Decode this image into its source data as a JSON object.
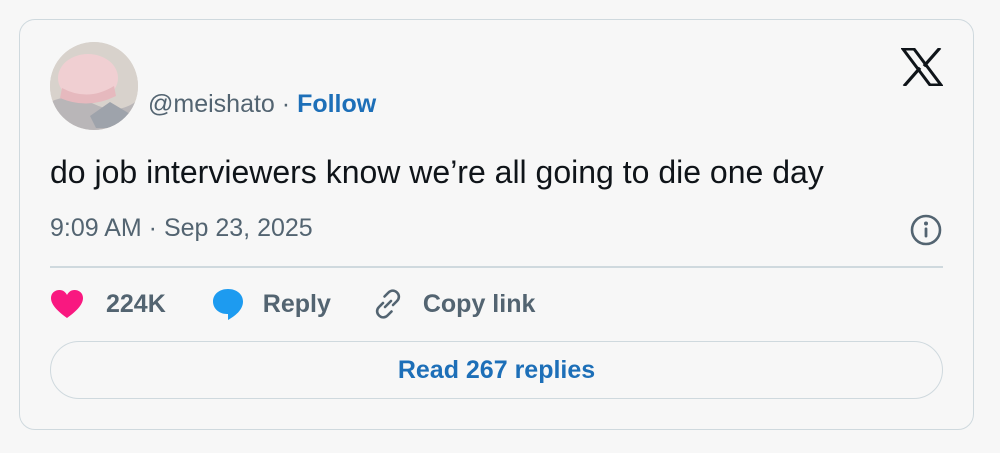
{
  "tweet": {
    "handle": "@meishato",
    "separator": "·",
    "follow_label": "Follow",
    "text": "do job interviewers know we’re all going to die one day",
    "timestamp": "9:09 AM · Sep 23, 2025",
    "likes_count": "224K",
    "reply_label": "Reply",
    "copy_link_label": "Copy link",
    "read_replies_label": "Read 267 replies"
  },
  "icons": {
    "brand": "x-logo-icon",
    "info": "info-icon",
    "like": "heart-icon",
    "reply": "speech-bubble-icon",
    "copy": "link-icon"
  },
  "colors": {
    "link_blue": "#1d6fb8",
    "heart_pink": "#f91880",
    "bubble_blue": "#1d9bf0",
    "text_dark": "#0f1419",
    "text_gray": "#536471",
    "border": "#cfd9de"
  }
}
